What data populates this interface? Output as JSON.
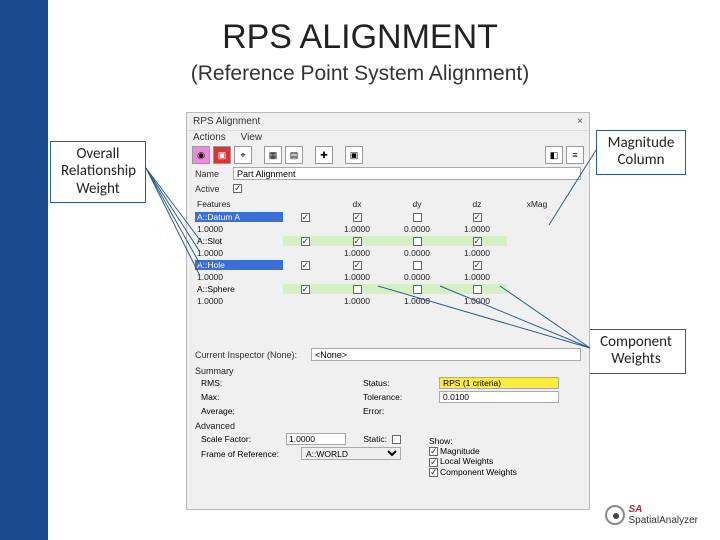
{
  "slide": {
    "title": "RPS ALIGNMENT",
    "subtitle": "(Reference Point System Alignment)"
  },
  "callouts": {
    "left": "Overall Relationship Weight",
    "topRight": "Magnitude Column",
    "botRight": "Component Weights"
  },
  "dialog": {
    "title": "RPS Alignment",
    "close": "×",
    "menu": {
      "actions": "Actions",
      "view": "View"
    },
    "name_label": "Name",
    "name_value": "Part Alignment",
    "active_label": "Active",
    "grid": {
      "headers": [
        "Features",
        "",
        "dx",
        "dy",
        "dz",
        "xMag"
      ],
      "rows": [
        {
          "label": "A::Datum A",
          "weight": "1.0000",
          "dx_ck": true,
          "dx": "1.0000",
          "dy_ck": false,
          "dy": "0.0000",
          "dz_ck": true,
          "dz": "1.0000",
          "hl": "blue"
        },
        {
          "label": "A::Slot",
          "weight": "1.0000",
          "dx_ck": true,
          "dx": "1.0000",
          "dy_ck": false,
          "dy": "0.0000",
          "dz_ck": true,
          "dz": "1.0000",
          "hl": "green"
        },
        {
          "label": "A::Hole",
          "weight": "1.0000",
          "dx_ck": true,
          "dx": "1.0000",
          "dy_ck": false,
          "dy": "0.0000",
          "dz_ck": true,
          "dz": "1.0000",
          "hl": "blue"
        },
        {
          "label": "A::Sphere",
          "weight": "1.0000",
          "dx_ck": false,
          "dx": "1.0000",
          "dy_ck": false,
          "dy": "1.0000",
          "dz_ck": false,
          "dz": "1.0000",
          "hl": "green"
        }
      ]
    },
    "inspector_label": "Current Inspector (None):",
    "inspector_value": "<None>",
    "summary": {
      "heading": "Summary",
      "rms_label": "RMS:",
      "status_label": "Status:",
      "status_value": "RPS (1 criteria)",
      "max_label": "Max:",
      "tolerance_label": "Tolerance:",
      "tolerance_value": "0.0100",
      "avg_label": "Average:",
      "error_label": "Error:"
    },
    "advanced": {
      "heading": "Advanced",
      "scale_label": "Scale Factor:",
      "scale_value": "1.0000",
      "static_label": "Static:",
      "frame_label": "Frame of Reference:",
      "frame_value": "A::WORLD",
      "show_label": "Show:",
      "show_mag": "Magnitude",
      "show_local": "Local Weights",
      "show_comp": "Component Weights"
    }
  },
  "logo": {
    "brand": "SA",
    "name": "SpatialAnalyzer"
  }
}
